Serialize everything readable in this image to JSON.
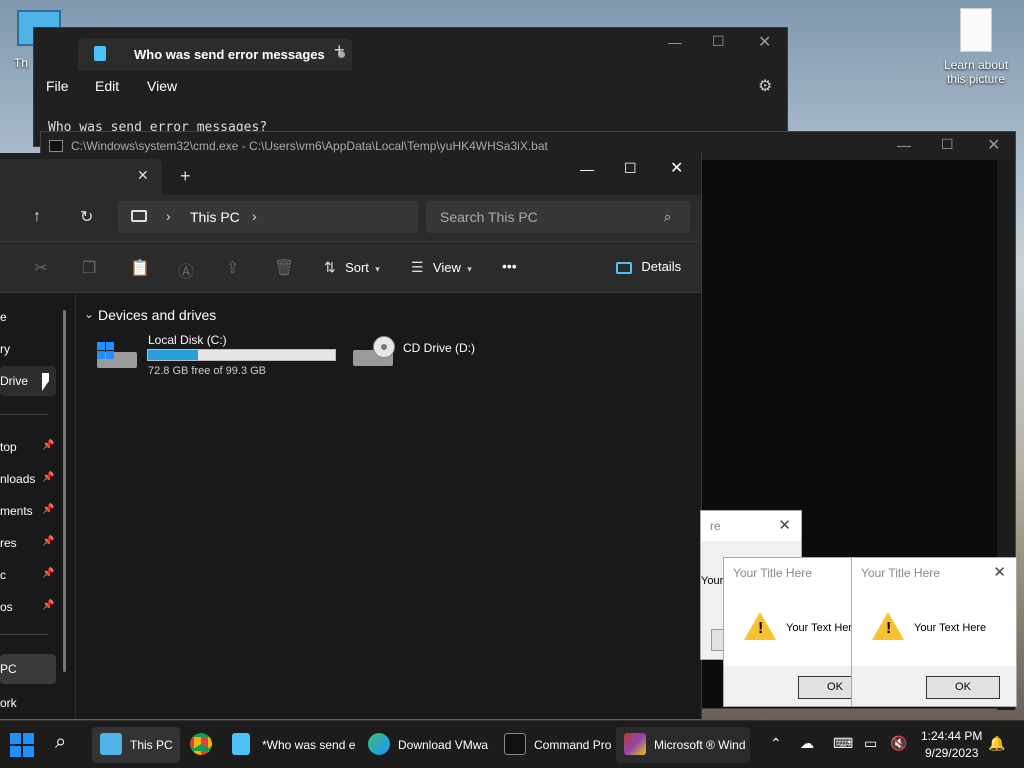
{
  "desktop": {
    "icon_this_pc_label": "Th",
    "icon_learn_label_1": "Learn about",
    "icon_learn_label_2": "this picture"
  },
  "notepad": {
    "tab_title": "Who was send error messages",
    "menu": [
      "File",
      "Edit",
      "View"
    ],
    "content": "Who was send error messages?"
  },
  "cmd": {
    "title": "C:\\Windows\\system32\\cmd.exe - C:\\Users\\vm6\\AppData\\Local\\Temp\\yuHK4WHSa3iX.bat"
  },
  "explorer": {
    "address_location": "This PC",
    "search_placeholder": "Search This PC",
    "toolbar": {
      "sort_label": "Sort",
      "view_label": "View",
      "more_label": "•••",
      "details_label": "Details"
    },
    "nav_items": [
      {
        "label": "e",
        "pinned": false
      },
      {
        "label": "ry",
        "pinned": false
      },
      {
        "label": "Drive",
        "pinned": false
      },
      {
        "label": "top",
        "pinned": true
      },
      {
        "label": "nloads",
        "pinned": true
      },
      {
        "label": "ments",
        "pinned": true
      },
      {
        "label": "res",
        "pinned": true
      },
      {
        "label": "c",
        "pinned": true
      },
      {
        "label": "os",
        "pinned": true
      },
      {
        "label": "PC",
        "pinned": false
      },
      {
        "label": "ork",
        "pinned": false
      }
    ],
    "section_title": "Devices and drives",
    "drives": [
      {
        "name": "Local Disk (C:)",
        "free_text": "72.8 GB free of 99.3 GB",
        "used_fraction": 0.27
      },
      {
        "name": "CD Drive (D:)"
      }
    ]
  },
  "dialogs": {
    "back_title_partial": "re",
    "back_text_partial": "Your",
    "title": "Your Title Here",
    "text": "Your Text Here",
    "ok_label": "OK"
  },
  "taskbar": {
    "apps": [
      {
        "label": "This PC"
      },
      {
        "label": "*Who was send e"
      },
      {
        "label": "Download VMwa"
      },
      {
        "label": "Command Pro"
      },
      {
        "label": "Microsoft ® Wind"
      }
    ],
    "time": "1:24:44 PM",
    "date": "9/29/2023"
  }
}
